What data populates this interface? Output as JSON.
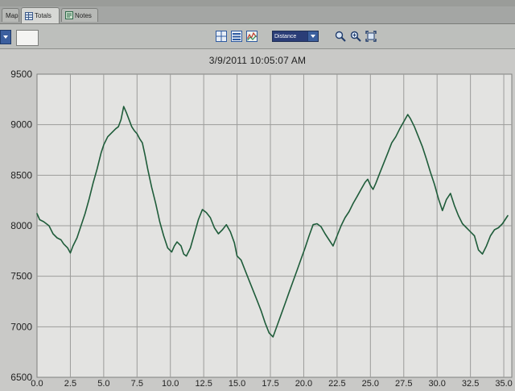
{
  "tabs": [
    {
      "label": "Map",
      "icon": "map-icon"
    },
    {
      "label": "Totals",
      "icon": "totals-icon"
    },
    {
      "label": "Notes",
      "icon": "notes-icon"
    }
  ],
  "toolbar": {
    "metric_select_value": "Distance",
    "buttons": [
      "chart-layout-icon",
      "list-icon",
      "graph-icon",
      "zoom-icon",
      "zoom-in-icon",
      "fit-icon"
    ]
  },
  "chart_data": {
    "type": "line",
    "title": "3/9/2011 10:05:07 AM",
    "xlabel": "",
    "ylabel": "",
    "xlim": [
      0,
      35.6
    ],
    "ylim": [
      6500,
      9500
    ],
    "x_ticks": [
      "0.0",
      "2.5",
      "5.0",
      "7.5",
      "10.0",
      "12.5",
      "15.0",
      "17.5",
      "20.0",
      "22.5",
      "25.0",
      "27.5",
      "30.0",
      "32.5",
      "35.0"
    ],
    "y_ticks": [
      "9500",
      "9000",
      "8500",
      "8000",
      "7500",
      "7000",
      "6500"
    ],
    "grid": true,
    "line_color": "#1f5c3a",
    "series": [
      {
        "name": "",
        "x": [
          0.0,
          0.2,
          0.5,
          0.9,
          1.2,
          1.5,
          1.8,
          2.0,
          2.3,
          2.5,
          2.7,
          3.0,
          3.3,
          3.6,
          3.9,
          4.2,
          4.5,
          4.8,
          5.0,
          5.3,
          5.6,
          5.9,
          6.1,
          6.3,
          6.5,
          6.7,
          6.9,
          7.1,
          7.3,
          7.5,
          7.7,
          7.9,
          8.1,
          8.3,
          8.6,
          8.9,
          9.2,
          9.5,
          9.8,
          10.1,
          10.3,
          10.5,
          10.8,
          11.0,
          11.2,
          11.5,
          11.8,
          12.1,
          12.4,
          12.7,
          13.0,
          13.3,
          13.6,
          13.9,
          14.2,
          14.5,
          14.8,
          15.0,
          15.3,
          15.6,
          15.9,
          16.2,
          16.5,
          16.8,
          17.1,
          17.4,
          17.7,
          18.0,
          18.3,
          18.6,
          18.9,
          19.2,
          19.5,
          19.8,
          20.1,
          20.4,
          20.7,
          21.0,
          21.3,
          21.6,
          21.9,
          22.2,
          22.5,
          22.8,
          23.1,
          23.4,
          23.7,
          24.0,
          24.3,
          24.6,
          24.8,
          25.0,
          25.2,
          25.4,
          25.7,
          26.0,
          26.3,
          26.6,
          26.9,
          27.2,
          27.5,
          27.8,
          28.0,
          28.3,
          28.6,
          28.9,
          29.2,
          29.5,
          29.8,
          30.1,
          30.4,
          30.7,
          31.0,
          31.3,
          31.6,
          31.9,
          32.2,
          32.5,
          32.8,
          33.1,
          33.4,
          33.7,
          34.0,
          34.3,
          34.6,
          34.9,
          35.1,
          35.3
        ],
        "y": [
          8120,
          8060,
          8040,
          8000,
          7920,
          7880,
          7860,
          7820,
          7780,
          7730,
          7800,
          7880,
          8000,
          8120,
          8260,
          8420,
          8560,
          8720,
          8800,
          8880,
          8920,
          8960,
          8980,
          9050,
          9180,
          9120,
          9050,
          8980,
          8940,
          8910,
          8860,
          8820,
          8700,
          8560,
          8380,
          8220,
          8040,
          7900,
          7780,
          7740,
          7800,
          7840,
          7800,
          7720,
          7700,
          7780,
          7920,
          8060,
          8160,
          8130,
          8080,
          7980,
          7920,
          7960,
          8010,
          7940,
          7830,
          7700,
          7660,
          7560,
          7460,
          7360,
          7260,
          7160,
          7040,
          6940,
          6900,
          7010,
          7120,
          7230,
          7340,
          7450,
          7560,
          7670,
          7780,
          7900,
          8010,
          8020,
          7990,
          7920,
          7860,
          7800,
          7900,
          8000,
          8080,
          8140,
          8220,
          8290,
          8360,
          8430,
          8460,
          8400,
          8360,
          8420,
          8520,
          8620,
          8720,
          8820,
          8880,
          8960,
          9030,
          9100,
          9060,
          8980,
          8880,
          8780,
          8660,
          8530,
          8410,
          8270,
          8150,
          8260,
          8320,
          8200,
          8100,
          8020,
          7980,
          7940,
          7900,
          7760,
          7720,
          7800,
          7900,
          7960,
          7980,
          8020,
          8060,
          8100
        ]
      }
    ]
  }
}
